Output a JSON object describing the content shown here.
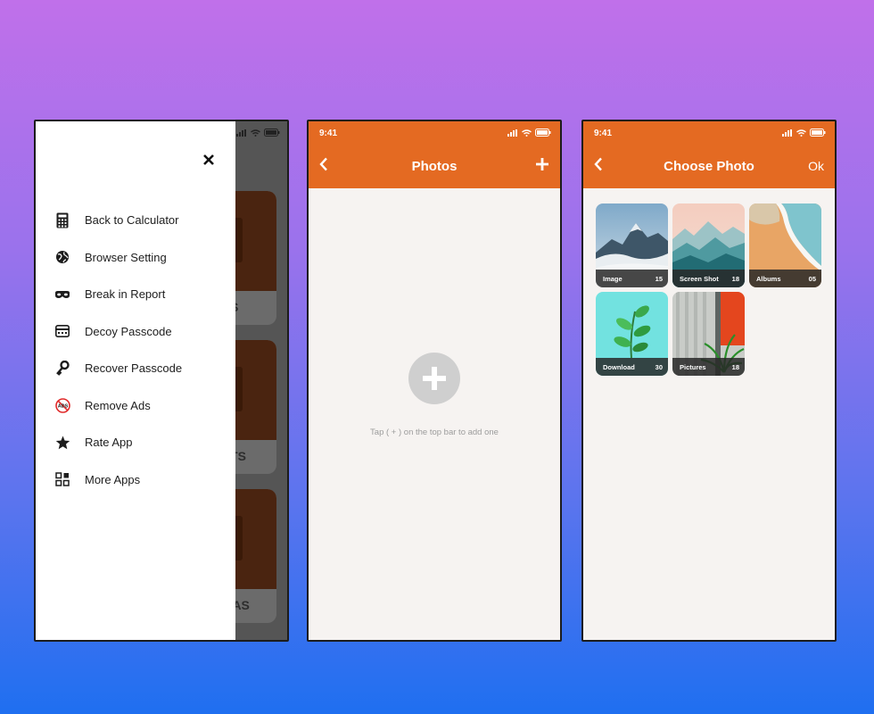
{
  "colors": {
    "accent": "#e46a22",
    "background_top": "#c070ea",
    "background_bottom": "#1f6ff0",
    "screen_bg": "#f6f3f1"
  },
  "drawer_screen": {
    "close_icon": "close-icon",
    "background_cards": [
      {
        "label": "DS"
      },
      {
        "label": "CTS"
      },
      {
        "label": "TIAS"
      }
    ],
    "menu": [
      {
        "label": "Back to Calculator",
        "icon": "calculator-icon"
      },
      {
        "label": "Browser Setting",
        "icon": "globe-icon"
      },
      {
        "label": "Break in Report",
        "icon": "mask-icon"
      },
      {
        "label": "Decoy Passcode",
        "icon": "keypad-icon"
      },
      {
        "label": "Recover Passcode",
        "icon": "key-icon"
      },
      {
        "label": "Remove Ads",
        "icon": "no-ads-icon"
      },
      {
        "label": "Rate App",
        "icon": "star-icon"
      },
      {
        "label": "More Apps",
        "icon": "grid-icon"
      }
    ]
  },
  "photos_screen": {
    "time": "9:41",
    "title": "Photos",
    "add_icon": "plus-icon",
    "empty_hint": "Tap ( + ) on the top bar to add one"
  },
  "choose_photo_screen": {
    "time": "9:41",
    "title": "Choose Photo",
    "ok_label": "Ok",
    "albums": [
      {
        "name": "Image",
        "count": "15"
      },
      {
        "name": "Screen Shot",
        "count": "18"
      },
      {
        "name": "Albums",
        "count": "05"
      },
      {
        "name": "Download",
        "count": "30"
      },
      {
        "name": "Pictures",
        "count": "18"
      }
    ]
  }
}
